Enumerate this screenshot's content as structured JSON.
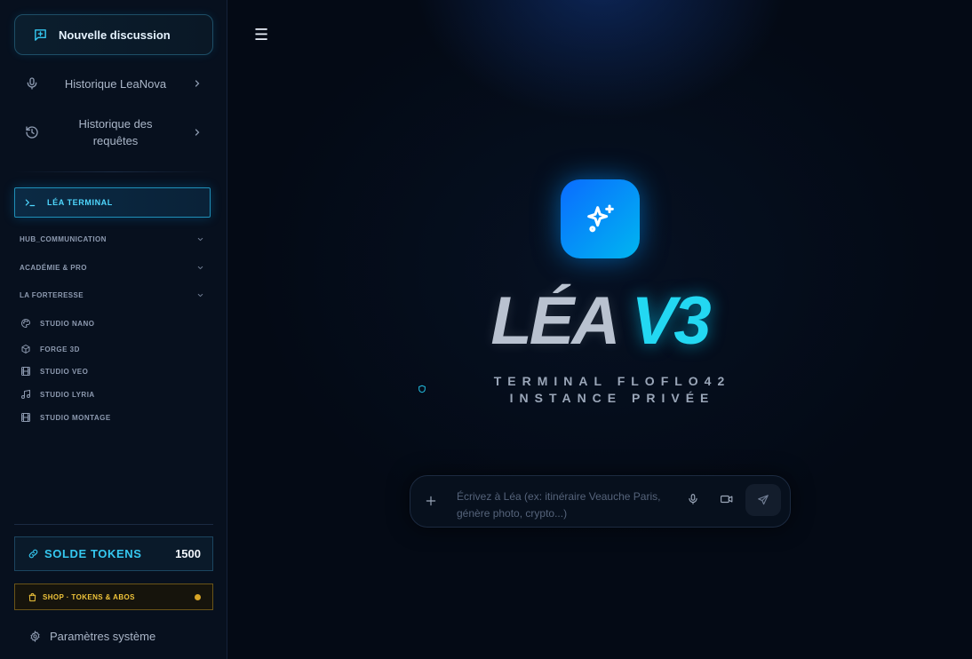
{
  "sidebar": {
    "new_chat_label": "Nouvelle discussion",
    "nav": [
      {
        "label": "Historique LeaNova",
        "icon": "mic-icon"
      },
      {
        "label": "Historique des requêtes",
        "icon": "history-icon"
      }
    ],
    "terminal_label": "LÉA TERMINAL",
    "sections": [
      {
        "label": "HUB_COMMUNICATION"
      },
      {
        "label": "ACADÉMIE & PRO"
      },
      {
        "label": "LA FORTERESSE"
      }
    ],
    "studios": [
      {
        "label": "STUDIO NANO",
        "icon": "palette-icon"
      },
      {
        "label": "FORGE 3D",
        "icon": "cube-icon"
      },
      {
        "label": "STUDIO VEO",
        "icon": "film-icon"
      },
      {
        "label": "STUDIO LYRIA",
        "icon": "music-icon"
      },
      {
        "label": "STUDIO MONTAGE",
        "icon": "film-icon"
      }
    ],
    "tokens": {
      "label": "SOLDE TOKENS",
      "value": "1500"
    },
    "shop_label": "SHOP · TOKENS & ABOS",
    "settings_label": "Paramètres système"
  },
  "main": {
    "menu_glyph": "☰",
    "title_part1": "LÉA ",
    "title_part2": "V3",
    "subtitle": "TERMINAL FLOFLO42 INSTANCE PRIVÉE",
    "composer": {
      "placeholder": "Écrivez à Léa (ex: itinéraire Veauche Paris, génère photo, crypto...)"
    }
  },
  "colors": {
    "accent_cyan": "#23d8f2",
    "accent_blue": "#0a6cff",
    "shop_gold": "#f0c43a",
    "background": "#050b16"
  }
}
